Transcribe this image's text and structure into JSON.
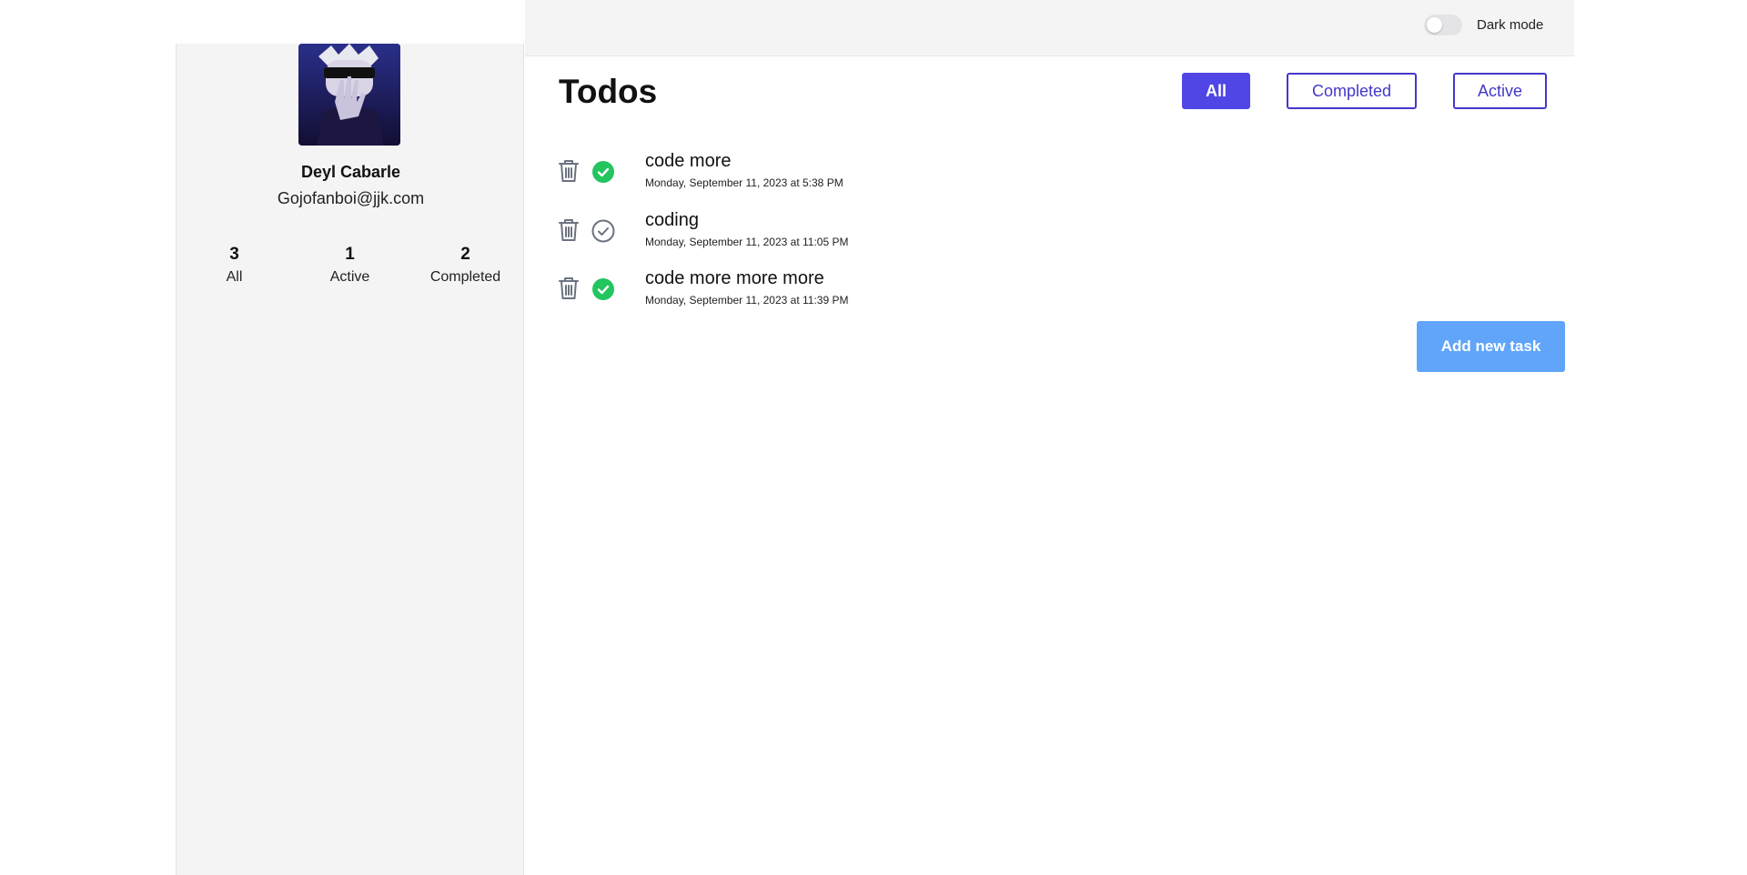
{
  "profile": {
    "name": "Deyl Cabarle",
    "email": "Gojofanboi@jjk.com",
    "stats": {
      "all": {
        "count": "3",
        "label": "All"
      },
      "active": {
        "count": "1",
        "label": "Active"
      },
      "completed": {
        "count": "2",
        "label": "Completed"
      }
    }
  },
  "topbar": {
    "dark_mode_label": "Dark mode",
    "dark_mode_on": false
  },
  "main": {
    "title": "Todos",
    "filters": {
      "all": "All",
      "completed": "Completed",
      "active": "Active",
      "selected": "all"
    },
    "todos": [
      {
        "title": "code more",
        "date": "Monday, September 11, 2023 at 5:38 PM",
        "completed": true
      },
      {
        "title": "coding",
        "date": "Monday, September 11, 2023 at 11:05 PM",
        "completed": false
      },
      {
        "title": "code more more more",
        "date": "Monday, September 11, 2023 at 11:39 PM",
        "completed": true
      }
    ],
    "add_button_label": "Add new task"
  },
  "colors": {
    "accent": "#4f46e5",
    "accent_border": "#4338ca",
    "add_button": "#60a5fa",
    "done_green": "#22c55e",
    "icon_gray": "#6b7280",
    "panel_bg": "#f4f4f4"
  },
  "icons": {
    "delete": "trash-icon",
    "done": "check-circle-filled-icon",
    "not_done": "check-circle-outline-icon"
  }
}
